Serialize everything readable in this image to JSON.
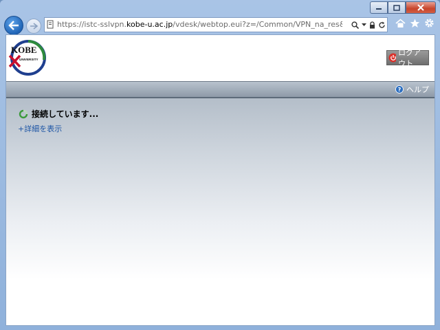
{
  "browser": {
    "url_prefix": "https://istc-sslvpn.",
    "url_domain": "kobe-u.ac.jp",
    "url_path": "/vdesk/webtop.eui?z=/Common/VPN_na_res&webtop=/Co"
  },
  "header": {
    "logo_text": "KOBE",
    "logo_subtext": "UNIVERSITY",
    "logout_label": "ログアウト"
  },
  "helpbar": {
    "help_label": "ヘルプ"
  },
  "main": {
    "status_text": "接続しています...",
    "details_link": "+詳細を表示"
  },
  "colors": {
    "link": "#1d55a5",
    "logo_red": "#c8102e",
    "logo_blue": "#1f3f8f",
    "logo_green": "#2e8b3d"
  }
}
